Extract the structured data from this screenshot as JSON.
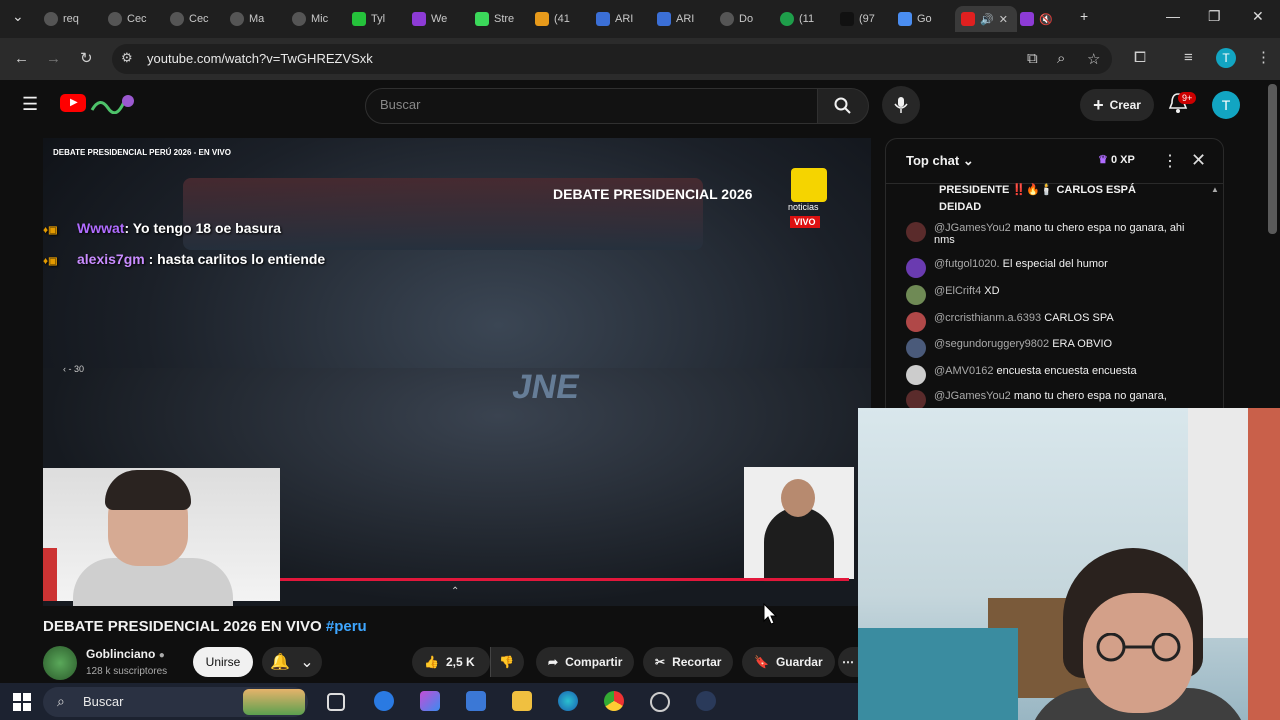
{
  "browser": {
    "tabs": [
      "req",
      "Cec",
      "Cec",
      "Ma",
      "Mic",
      "Tyl",
      "We",
      "Stre",
      "(41",
      "ARI",
      "ARI",
      "Do",
      "(11",
      "(97",
      "Go"
    ],
    "url": "youtube.com/watch?v=TwGHREZVSxk"
  },
  "youtube": {
    "search_placeholder": "Buscar",
    "create_label": "Crear",
    "notification_count": "9+",
    "avatar_letter": "T"
  },
  "video": {
    "overlay_title": "DEBATE PRESIDENCIAL PERÚ 2026 - EN VIVO",
    "badge": "DEBATE PRESIDENCIAL 2026",
    "logo_text": "noticias",
    "live_label": "VIVO",
    "floor_logo": "JNE",
    "seek_label": "‹  - 30",
    "overlay_chat": [
      {
        "name": "Wwwat",
        "text": ": Yo tengo 18 oe basura"
      },
      {
        "name": "alexis7gm",
        "text": " : hasta carlitos lo entiende"
      }
    ],
    "progress": 0.99
  },
  "meta": {
    "title": "DEBATE PRESIDENCIAL 2026 EN VIVO",
    "hashtag": "#peru",
    "channel": "Goblinciano",
    "subscribers": "128 k suscriptores",
    "join_label": "Unirse",
    "likes": "2,5 K",
    "share_label": "Compartir",
    "clip_label": "Recortar",
    "save_label": "Guardar"
  },
  "chat": {
    "header": "Top chat",
    "xp": "0 XP",
    "first_line": "PRESIDENTE ‼️🔥🕯️ CARLOS ESPÁ",
    "first_line2": "DEIDAD",
    "messages": [
      {
        "user": "@JGamesYou2",
        "text": "mano tu chero espa no ganara, ahi nms",
        "color": "#5a2b2b"
      },
      {
        "user": "@futgol1020.",
        "text": "El especial del humor",
        "color": "#6a3bb0"
      },
      {
        "user": "@ElCrift4",
        "text": "XD",
        "color": "#6f8a55"
      },
      {
        "user": "@crcristhianm.a.6393",
        "text": "CARLOS SPA",
        "color": "#b04848"
      },
      {
        "user": "@segundoruggery9802",
        "text": "ERA OBVIO",
        "color": "#4a5a7a"
      },
      {
        "user": "@AMV0162",
        "text": "encuesta encuesta encuesta",
        "color": "#cccccc"
      },
      {
        "user": "@JGamesYou2",
        "text": "mano tu chero espa no ganara,",
        "color": "#5a2b2b"
      }
    ]
  },
  "taskbar": {
    "search_label": "Buscar"
  }
}
